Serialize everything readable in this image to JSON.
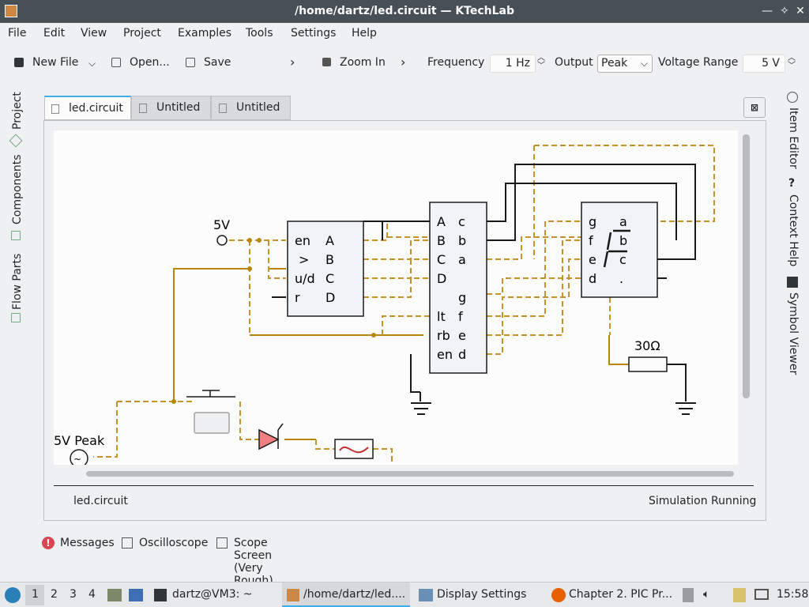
{
  "window": {
    "title": "/home/dartz/led.circuit — KTechLab"
  },
  "menu": [
    "File",
    "Edit",
    "View",
    "Project",
    "Examples",
    "Tools",
    "Settings",
    "Help"
  ],
  "toolbar": {
    "new_file": "New File",
    "open": "Open...",
    "save": "Save",
    "zoom_in": "Zoom In",
    "frequency_label": "Frequency",
    "frequency_value": "1 Hz",
    "output_label": "Output",
    "output_value": "Peak",
    "voltage_label": "Voltage Range",
    "voltage_value": "5 V"
  },
  "left_sidebar": [
    "Project",
    "Components",
    "Flow Parts"
  ],
  "right_sidebar": [
    "Item Editor",
    "Context Help",
    "Symbol Viewer"
  ],
  "tabs": [
    "led.circuit",
    "Untitled",
    "Untitled"
  ],
  "circuit": {
    "supply_label": "5V",
    "source_label": "5V Peak",
    "resistor_label": "30Ω",
    "counter_pins_left": [
      "en",
      ">",
      "u/d",
      "r"
    ],
    "counter_pins_right": [
      "A",
      "B",
      "C",
      "D"
    ],
    "decoder_pins_left": [
      "A",
      "B",
      "C",
      "D",
      "lt",
      "rb",
      "en"
    ],
    "decoder_pins_right": [
      "c",
      "b",
      "a",
      "g",
      "f",
      "e",
      "d"
    ],
    "display_pins_left": [
      "g",
      "f",
      "e",
      "d"
    ],
    "display_pins_right": [
      "a",
      "b",
      "c",
      "."
    ]
  },
  "status": {
    "file": "led.circuit",
    "state": "Simulation Running"
  },
  "bottom_tools": [
    "Messages",
    "Oscilloscope",
    "Scope Screen (Very Rough)"
  ],
  "taskbar": {
    "desktops": [
      "1",
      "2",
      "3",
      "4"
    ],
    "tasks": [
      "dartz@VM3: ~",
      "/home/dartz/led....",
      "Display Settings",
      "Chapter 2. PIC Pr..."
    ],
    "clock": "15:58"
  }
}
